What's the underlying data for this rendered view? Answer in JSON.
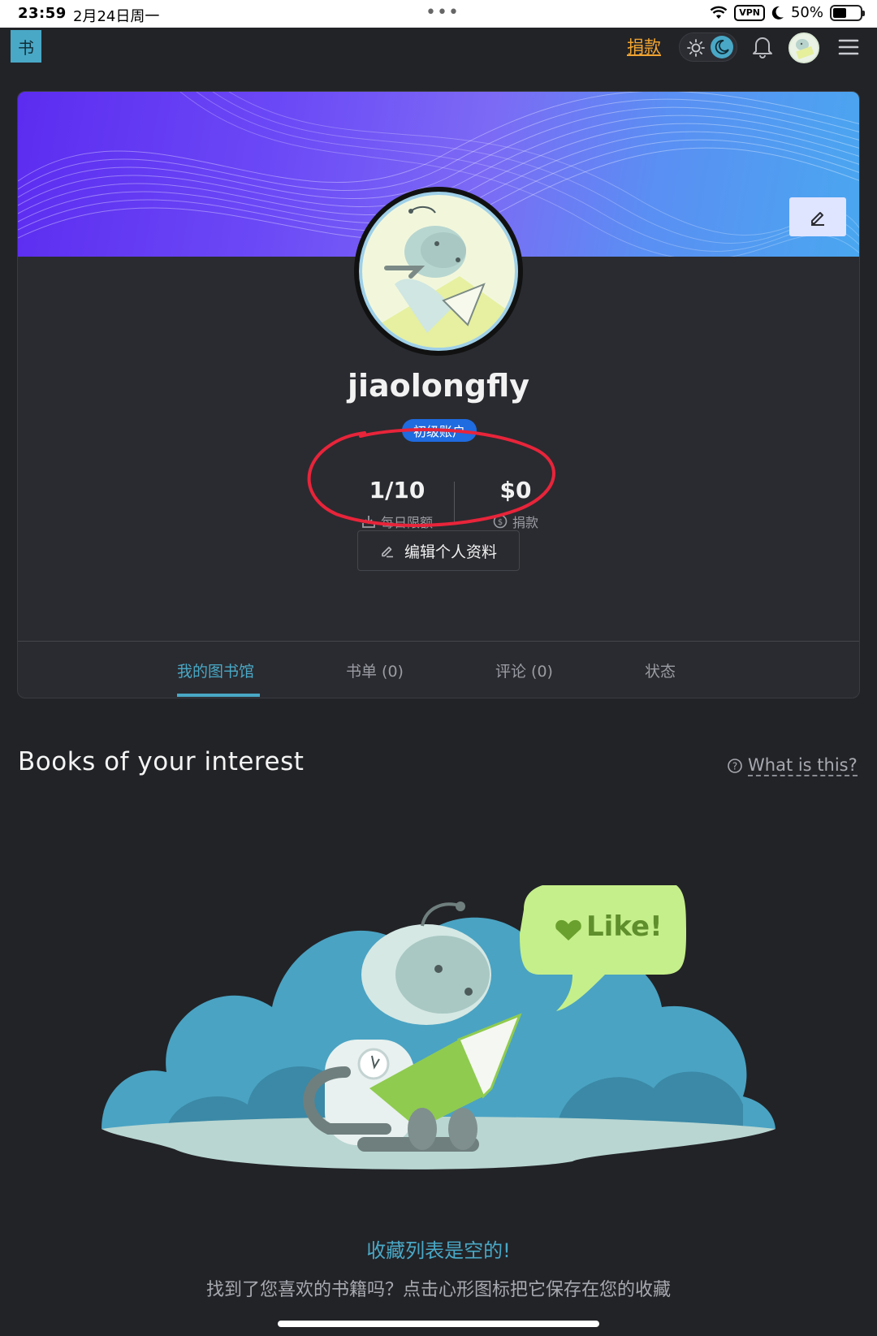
{
  "status_bar": {
    "time": "23:59",
    "date": "2月24日周一",
    "dots": "•••",
    "vpn": "VPN",
    "battery": "50%",
    "battery_level": 0.5
  },
  "nav": {
    "logo": "书",
    "donate": "捐款"
  },
  "profile": {
    "username": "jiaolongfly",
    "badge": "初级账户",
    "stats": {
      "daily_value": "1/10",
      "daily_label": "每日限额",
      "donation_value": "$0",
      "donation_label": "捐款"
    },
    "edit_profile": "编辑个人资料"
  },
  "tabs": [
    {
      "label": "我的图书馆",
      "active": true
    },
    {
      "label": "书单 (0)",
      "active": false
    },
    {
      "label": "评论 (0)",
      "active": false
    },
    {
      "label": "状态",
      "active": false
    }
  ],
  "interest": {
    "title": "Books of your interest",
    "help_link": "What is this?",
    "bubble_text": "Like!",
    "empty_title": "收藏列表是空的!",
    "empty_desc": "找到了您喜欢的书籍吗？点击心形图标把它保存在您的收藏"
  },
  "colors": {
    "accent": "#49a8c6",
    "donate": "#f2a531",
    "badge": "#1f6be0",
    "annotation": "#e8243a"
  }
}
